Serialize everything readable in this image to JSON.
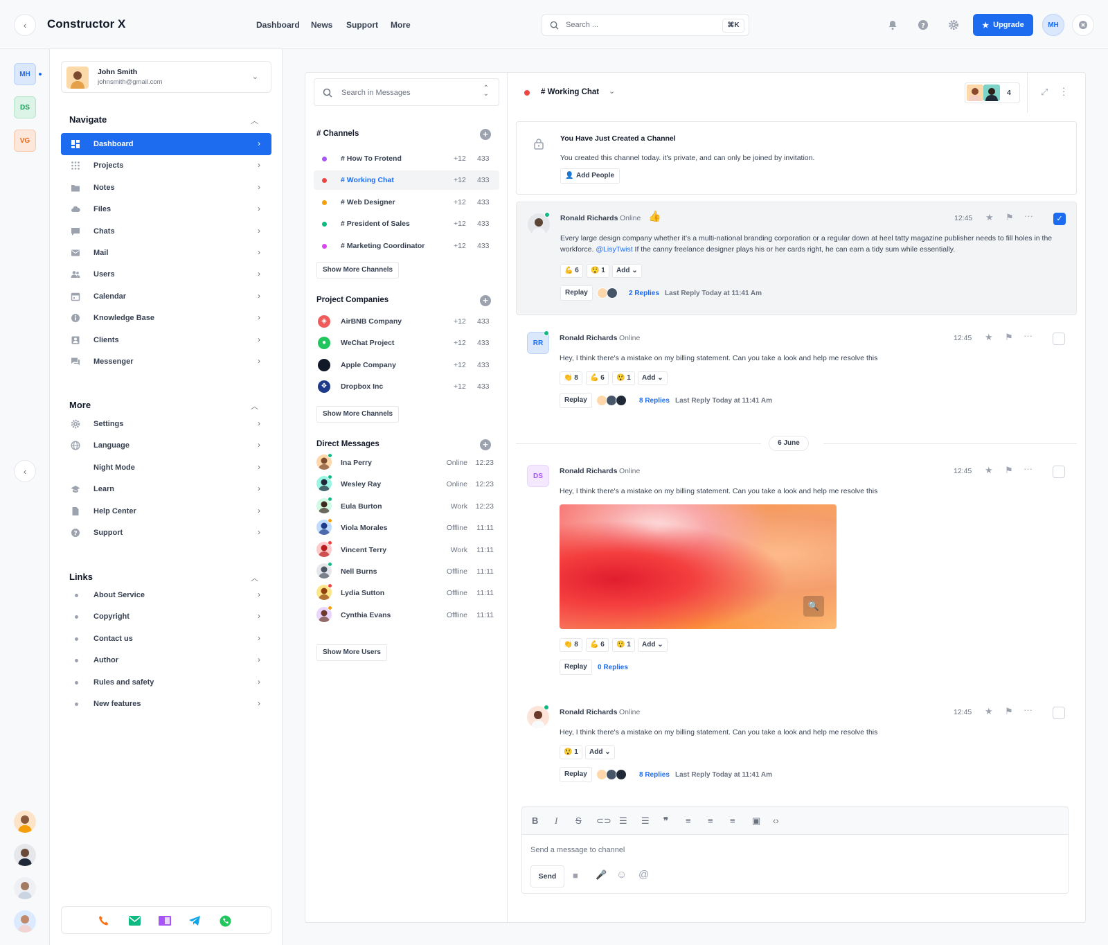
{
  "app": {
    "title": "Constructor X"
  },
  "topnav": [
    "Dashboard",
    "News",
    "Support",
    "More"
  ],
  "search": {
    "placeholder": "Search ...",
    "shortcut": "⌘K"
  },
  "upgrade_label": "Upgrade",
  "user_initials": "MH",
  "workspaces": [
    {
      "initials": "MH",
      "bg": "#dbe8fb",
      "fg": "#1d6cf0"
    },
    {
      "initials": "DS",
      "bg": "#dcf3e7",
      "fg": "#159a55"
    },
    {
      "initials": "VG",
      "bg": "#fde7da",
      "fg": "#ea6a1c"
    }
  ],
  "user": {
    "name": "John Smith",
    "email": "johnsmith@gmail.com"
  },
  "sections": {
    "navigate": "Navigate",
    "more": "More",
    "links": "Links"
  },
  "nav": [
    {
      "label": "Dashboard",
      "icon": "dashboard-icon"
    },
    {
      "label": "Projects",
      "icon": "grid-icon"
    },
    {
      "label": "Notes",
      "icon": "folder-icon"
    },
    {
      "label": "Files",
      "icon": "cloud-icon"
    },
    {
      "label": "Chats",
      "icon": "chat-icon"
    },
    {
      "label": "Mail",
      "icon": "mail-icon"
    },
    {
      "label": "Users",
      "icon": "users-icon"
    },
    {
      "label": "Calendar",
      "icon": "calendar-icon"
    },
    {
      "label": "Knowledge Base",
      "icon": "info-icon"
    },
    {
      "label": "Clients",
      "icon": "contact-icon"
    },
    {
      "label": "Messenger",
      "icon": "messenger-icon"
    }
  ],
  "more": [
    {
      "label": "Settings",
      "icon": "gear-icon"
    },
    {
      "label": "Language",
      "icon": "globe-icon"
    },
    {
      "label": "Night Mode",
      "icon": "moon-icon"
    },
    {
      "label": "Learn",
      "icon": "graduation-icon"
    },
    {
      "label": "Help Center",
      "icon": "document-icon"
    },
    {
      "label": "Support",
      "icon": "help-icon"
    }
  ],
  "links": [
    "About Service",
    "Copyright",
    "Contact us",
    "Author",
    "Rules and safety",
    "New features"
  ],
  "messages_search_placeholder": "Search in Messages",
  "channels_header": "# Channels",
  "channels": [
    {
      "name": "# How To Frotend",
      "plus": "+12",
      "count": "433",
      "color": "#a855f7"
    },
    {
      "name": "# Working Chat",
      "plus": "+12",
      "count": "433",
      "color": "#ef4444"
    },
    {
      "name": "# Web Designer",
      "plus": "+12",
      "count": "433",
      "color": "#f59e0b"
    },
    {
      "name": "# President of Sales",
      "plus": "+12",
      "count": "433",
      "color": "#10b981"
    },
    {
      "name": "# Marketing Coordinator",
      "plus": "+12",
      "count": "433",
      "color": "#d946ef"
    }
  ],
  "show_more_channels": "Show More Channels",
  "companies_header": "Project Companies",
  "companies": [
    {
      "name": "AirBNB Company",
      "plus": "+12",
      "count": "433",
      "icon": "airbnb-icon",
      "color": "#ef5b5b"
    },
    {
      "name": "WeChat Project",
      "plus": "+12",
      "count": "433",
      "icon": "wechat-icon",
      "color": "#22c55e"
    },
    {
      "name": "Apple Company",
      "plus": "+12",
      "count": "433",
      "icon": "apple-icon",
      "color": "#111827"
    },
    {
      "name": "Dropbox Inc",
      "plus": "+12",
      "count": "433",
      "icon": "dropbox-icon",
      "color": "#1e3a8a"
    }
  ],
  "dm_header": "Direct Messages",
  "dms": [
    {
      "name": "Ina Perry",
      "status": "Online",
      "time": "12:23",
      "dot": "#10b981"
    },
    {
      "name": "Wesley Ray",
      "status": "Online",
      "time": "12:23",
      "dot": "#10b981"
    },
    {
      "name": "Eula Burton",
      "status": "Work",
      "time": "12:23",
      "dot": "#10b981"
    },
    {
      "name": "Viola Morales",
      "status": "Offline",
      "time": "11:11",
      "dot": "#f59e0b"
    },
    {
      "name": "Vincent Terry",
      "status": "Work",
      "time": "11:11",
      "dot": "#ef4444"
    },
    {
      "name": "Nell Burns",
      "status": "Offline",
      "time": "11:11",
      "dot": "#10b981"
    },
    {
      "name": "Lydia Sutton",
      "status": "Offline",
      "time": "11:11",
      "dot": "#ef4444"
    },
    {
      "name": "Cynthia Evans",
      "status": "Offline",
      "time": "11:11",
      "dot": "#f59e0b"
    }
  ],
  "show_more_users": "Show More Users",
  "chat": {
    "title": "# Working Chat",
    "members": "4"
  },
  "notice": {
    "title": "You Have Just Created a Channel",
    "text": "You created this channel today. it's private, and can only be joined by invitation.",
    "button": "Add People"
  },
  "messages": [
    {
      "name": "Ronald Richards",
      "status": "Online",
      "time": "12:45",
      "text_pre": "Every large design company whether it’s a multi-national branding corporation or a regular down at heel tatty magazine publisher needs to fill holes in the workforce.",
      "mention": "@LisyTwist",
      "text_post": " If the canny freelance designer plays his or her cards right, he can earn a tidy sum while essentially.",
      "reactions": [
        "💪 6",
        "😲 1"
      ],
      "add": "Add",
      "replay": "Replay",
      "replies": "2 Replies",
      "last": "Last Reply Today at 11:41 Am"
    },
    {
      "name": "Ronald Richards",
      "initials": "RR",
      "status": "Online",
      "time": "12:45",
      "text": "Hey, I think there's a mistake on my billing statement. Can you take a look and help me resolve this",
      "reactions": [
        "👏 8",
        "💪 6",
        "😲 1"
      ],
      "add": "Add",
      "replay": "Replay",
      "replies": "8 Replies",
      "last": "Last Reply Today at 11:41 Am"
    },
    {
      "name": "Ronald Richards",
      "initials": "DS",
      "status": "Online",
      "time": "12:45",
      "text": "Hey, I think there's a mistake on my billing statement. Can you take a look and help me resolve this",
      "reactions": [
        "👏 8",
        "💪 6",
        "😲 1"
      ],
      "add": "Add",
      "replay": "Replay",
      "replies": "0 Replies"
    },
    {
      "name": "Ronald Richards",
      "status": "Online",
      "time": "12:45",
      "text": "Hey, I think there's a mistake on my billing statement. Can you take a look and help me resolve this",
      "reactions": [
        "😲 1"
      ],
      "add": "Add",
      "replay": "Replay",
      "replies": "8 Replies",
      "last": "Last Reply Today at 11:41 Am"
    }
  ],
  "date_divider": "6 June",
  "composer": {
    "placeholder": "Send a message to channel",
    "send": "Send"
  }
}
